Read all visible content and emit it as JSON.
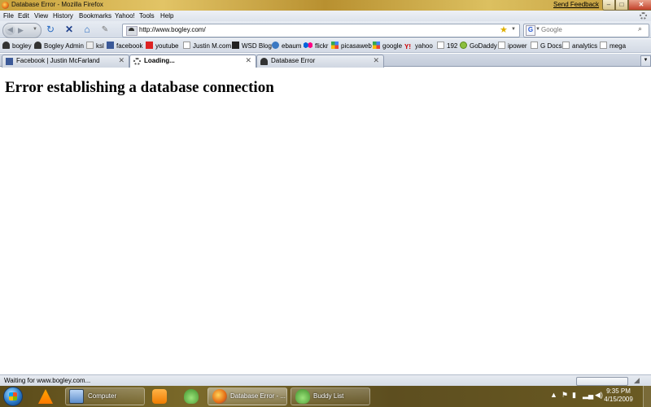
{
  "window": {
    "title": "Database Error - Mozilla Firefox",
    "send_feedback": "Send Feedback",
    "min": "–",
    "max": "□",
    "close": "✕"
  },
  "menu": [
    "File",
    "Edit",
    "View",
    "History",
    "Bookmarks",
    "Yahoo!",
    "Tools",
    "Help"
  ],
  "nav": {
    "url": "http://www.bogley.com/",
    "search_placeholder": "Google"
  },
  "bookmarks": [
    {
      "label": "bogley",
      "icon": "hat"
    },
    {
      "label": "Bogley Admin",
      "icon": "hat"
    },
    {
      "label": "ksl",
      "icon": "ksl"
    },
    {
      "label": "facebook",
      "icon": "fb"
    },
    {
      "label": "youtube",
      "icon": "yt"
    },
    {
      "label": "Justin M.com",
      "icon": "page"
    },
    {
      "label": "WSD Blog",
      "icon": "wsd"
    },
    {
      "label": "ebaum",
      "icon": "ebaum"
    },
    {
      "label": "flickr",
      "icon": "flickr"
    },
    {
      "label": "picasaweb",
      "icon": "google"
    },
    {
      "label": "google",
      "icon": "google"
    },
    {
      "label": "yahoo",
      "icon": "yahoo"
    },
    {
      "label": "192",
      "icon": "page"
    },
    {
      "label": "GoDaddy",
      "icon": "godaddy"
    },
    {
      "label": "ipower",
      "icon": "page"
    },
    {
      "label": "G Docs",
      "icon": "page"
    },
    {
      "label": "analytics",
      "icon": "page"
    },
    {
      "label": "mega",
      "icon": "page"
    }
  ],
  "tabs": [
    {
      "label": "Facebook | Justin McFarland",
      "icon": "fb",
      "active": false
    },
    {
      "label": "Loading...",
      "icon": "spin",
      "active": true
    },
    {
      "label": "Database Error",
      "icon": "hat",
      "active": false
    }
  ],
  "content": {
    "heading": "Error establishing a database connection"
  },
  "status": {
    "text": "Waiting for www.bogley.com..."
  },
  "taskbar": {
    "computer_label": "Computer",
    "firefox_label": "Database Error - ...",
    "buddy_label": "Buddy List",
    "time": "9:35 PM",
    "date": "4/15/2009"
  }
}
